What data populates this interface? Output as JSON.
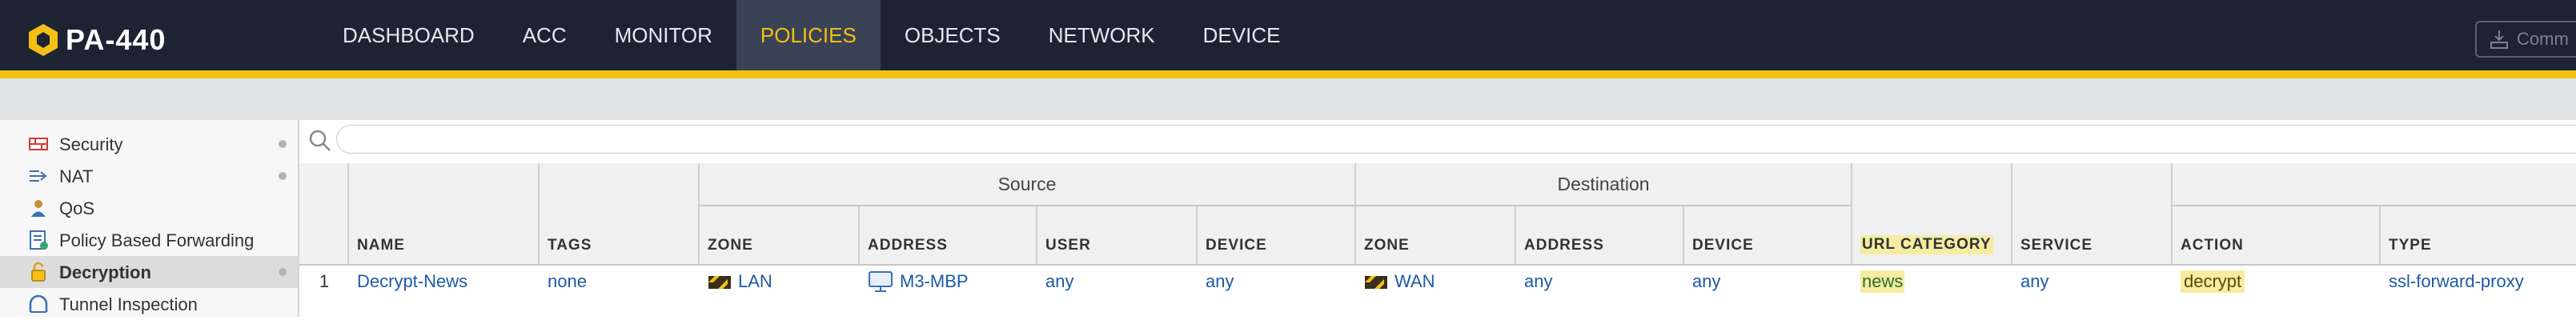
{
  "header": {
    "logo_text": "PA-440",
    "nav": [
      {
        "label": "DASHBOARD",
        "active": false
      },
      {
        "label": "ACC",
        "active": false
      },
      {
        "label": "MONITOR",
        "active": false
      },
      {
        "label": "POLICIES",
        "active": true
      },
      {
        "label": "OBJECTS",
        "active": false
      },
      {
        "label": "NETWORK",
        "active": false
      },
      {
        "label": "DEVICE",
        "active": false
      }
    ],
    "commit_label": "Comm"
  },
  "sidebar": {
    "items": [
      {
        "label": "Security",
        "icon": "security-rules-icon",
        "dot": true
      },
      {
        "label": "NAT",
        "icon": "nat-icon",
        "dot": true
      },
      {
        "label": "QoS",
        "icon": "qos-icon",
        "dot": false
      },
      {
        "label": "Policy Based Forwarding",
        "icon": "pbf-icon",
        "dot": false
      },
      {
        "label": "Decryption",
        "icon": "decryption-lock-icon",
        "dot": true,
        "active": true
      },
      {
        "label": "Tunnel Inspection",
        "icon": "tunnel-icon",
        "dot": false
      }
    ]
  },
  "table": {
    "groups": {
      "source": "Source",
      "destination": "Destination"
    },
    "columns": {
      "name": "NAME",
      "tags": "TAGS",
      "src_zone": "ZONE",
      "src_address": "ADDRESS",
      "src_user": "USER",
      "src_device": "DEVICE",
      "dst_zone": "ZONE",
      "dst_address": "ADDRESS",
      "dst_device": "DEVICE",
      "url_category": "URL CATEGORY",
      "service": "SERVICE",
      "action": "ACTION",
      "type": "TYPE"
    },
    "rows": [
      {
        "num": "1",
        "name": "Decrypt-News",
        "tags": "none",
        "src_zone": "LAN",
        "src_address": "M3-MBP",
        "src_user": "any",
        "src_device": "any",
        "dst_zone": "WAN",
        "dst_address": "any",
        "dst_device": "any",
        "url_category": "news",
        "service": "any",
        "action": "decrypt",
        "type": "ssl-forward-proxy"
      }
    ]
  },
  "colors": {
    "header_bg": "#1d2333",
    "accent": "#f3c013",
    "link": "#1c5aa6"
  }
}
